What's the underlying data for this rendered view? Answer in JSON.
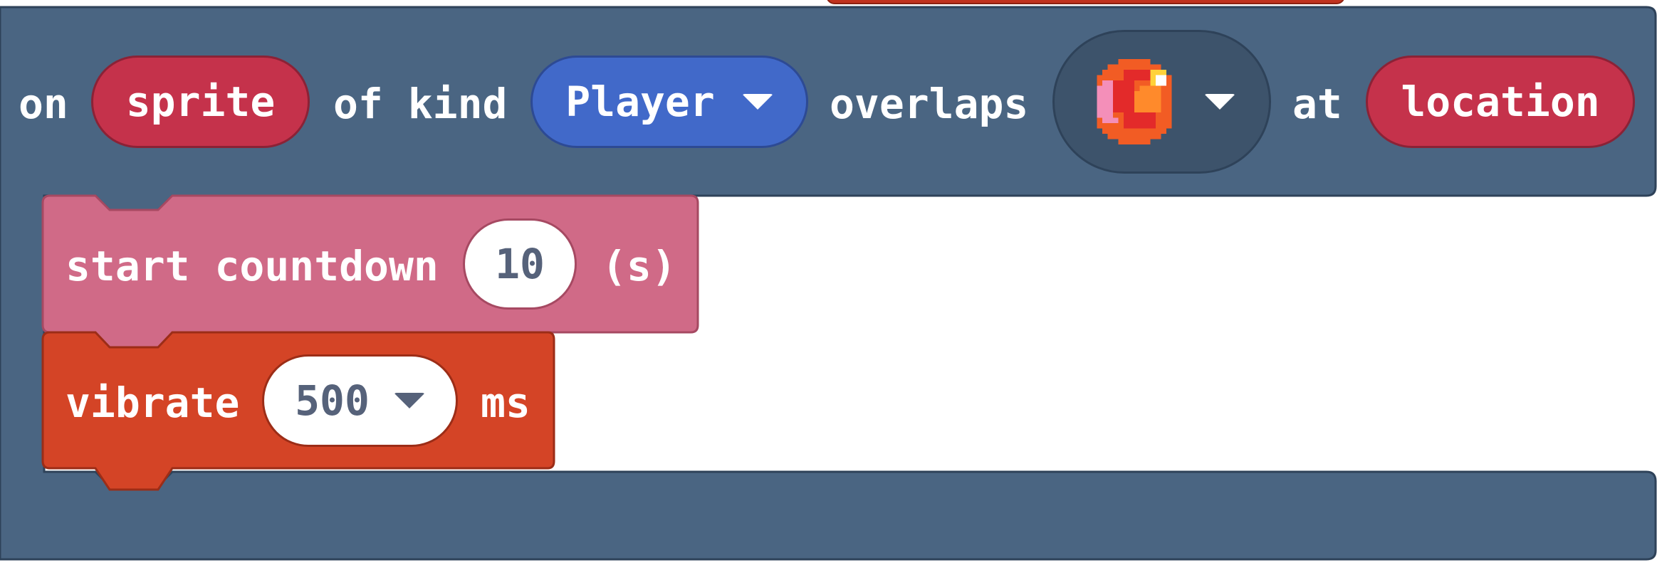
{
  "event_block": {
    "on_label": "on",
    "sprite_param": "sprite",
    "of_kind_label": "of kind",
    "kind_value": "Player",
    "overlaps_label": "overlaps",
    "tile_icon": "orange-fireball-tile-icon",
    "at_label": "at",
    "location_param": "location"
  },
  "countdown_block": {
    "label": "start countdown",
    "value": "10",
    "unit": "(s)"
  },
  "vibrate_block": {
    "label": "vibrate",
    "value": "500",
    "unit": "ms"
  },
  "colors": {
    "event_block": "#4a6582",
    "event_block_dark": "#3d536b",
    "variable_red": "#c5324b",
    "kind_blue": "#4169c9",
    "countdown_pink": "#d06a87",
    "vibrate_orange": "#d44426",
    "other_block_red": "#c1331f"
  }
}
